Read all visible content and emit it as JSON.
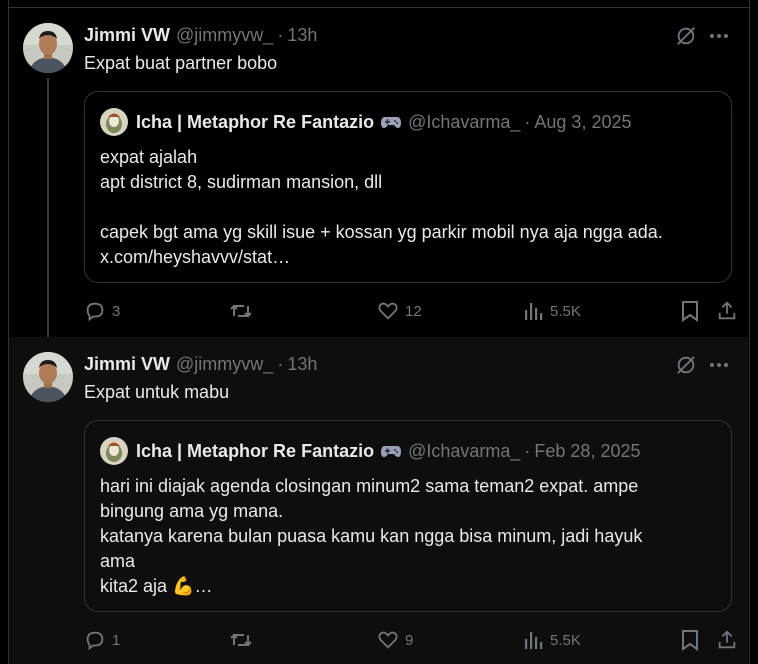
{
  "posts": [
    {
      "author_name": "Jimmi VW",
      "author_handle": "@jimmyvw_",
      "separator": "·",
      "time": "13h",
      "text": "Expat buat partner bobo",
      "quote": {
        "author_name": "Icha | Metaphor Re Fantazio",
        "author_handle": "@Ichavarma_",
        "separator": "·",
        "date": "Aug 3, 2025",
        "lines": [
          "expat ajalah",
          "apt district 8, sudirman mansion, dll",
          "",
          "capek bgt ama yg skill isue + kossan yg parkir mobil nya aja ngga ada.",
          "x.com/heyshavvv/stat…"
        ]
      },
      "replies": "3",
      "reposts": "",
      "likes": "12",
      "views": "5.5K"
    },
    {
      "author_name": "Jimmi VW",
      "author_handle": "@jimmyvw_",
      "separator": "·",
      "time": "13h",
      "text": "Expat untuk mabu",
      "quote": {
        "author_name": "Icha | Metaphor Re Fantazio",
        "author_handle": "@Ichavarma_",
        "separator": "·",
        "date": "Feb 28, 2025",
        "lines": [
          "hari ini diajak agenda closingan minum2 sama teman2 expat. ampe",
          "bingung ama yg mana.",
          "katanya karena bulan puasa kamu kan ngga bisa minum, jadi hayuk",
          "ama",
          "kita2 aja 💪…"
        ]
      },
      "replies": "1",
      "reposts": "",
      "likes": "9",
      "views": "5.5K"
    }
  ],
  "icons": {
    "grok": "grok-icon",
    "more": "more-icon",
    "reply": "reply-icon",
    "repost": "repost-icon",
    "like": "like-icon",
    "views": "views-icon",
    "bookmark": "bookmark-icon",
    "share": "share-icon",
    "game": "game-controller-icon"
  },
  "colors": {
    "background": "#000000",
    "text": "#e7e9ea",
    "muted": "#71767b",
    "border": "#2f3336"
  }
}
